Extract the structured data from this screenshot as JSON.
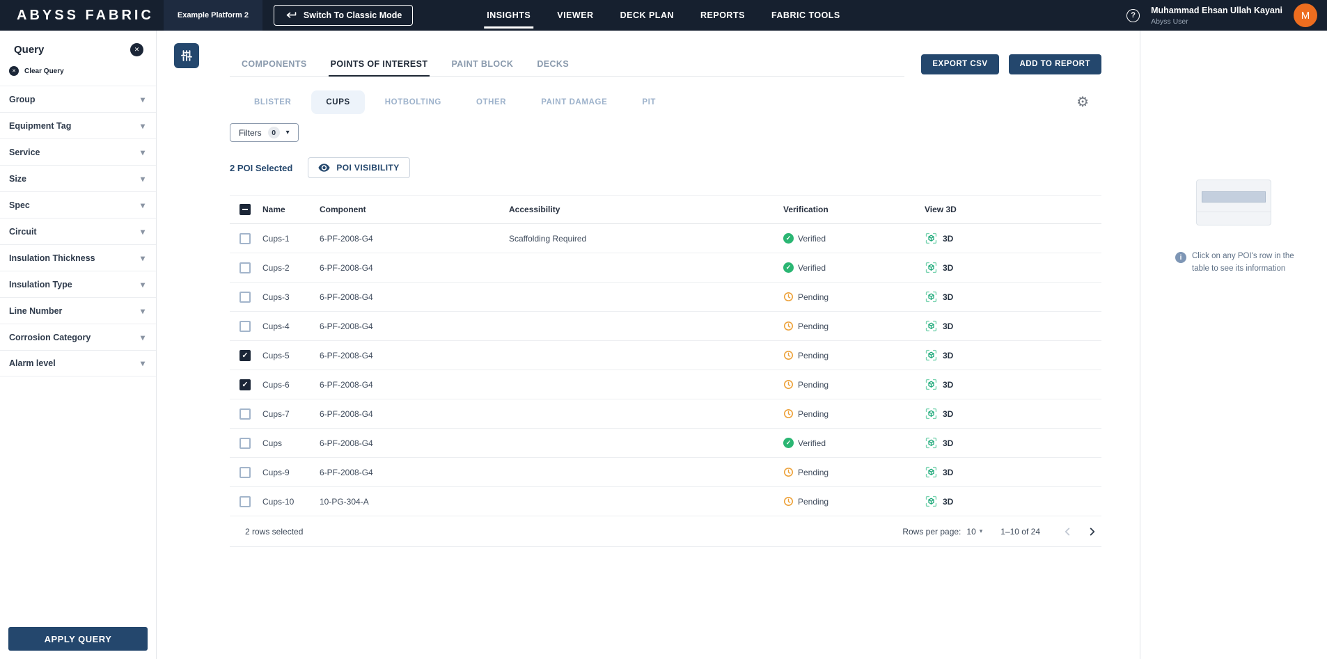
{
  "topbar": {
    "logo": "ABYSS FABRIC",
    "platform_name": "Example Platform 2",
    "classic_mode_label": "Switch To Classic Mode",
    "nav": [
      {
        "label": "INSIGHTS",
        "active": true
      },
      {
        "label": "VIEWER",
        "active": false
      },
      {
        "label": "DECK PLAN",
        "active": false
      },
      {
        "label": "REPORTS",
        "active": false
      },
      {
        "label": "FABRIC TOOLS",
        "active": false
      }
    ],
    "help_glyph": "?",
    "user": {
      "name": "Muhammad Ehsan Ullah Kayani",
      "role": "Abyss User",
      "avatar_initial": "M"
    }
  },
  "sidebar": {
    "title": "Query",
    "clear_label": "Clear Query",
    "filters": [
      "Group",
      "Equipment Tag",
      "Service",
      "Size",
      "Spec",
      "Circuit",
      "Insulation Thickness",
      "Insulation Type",
      "Line Number",
      "Corrosion Category",
      "Alarm level"
    ],
    "apply_label": "APPLY QUERY"
  },
  "main": {
    "tabs": [
      {
        "label": "COMPONENTS",
        "active": false
      },
      {
        "label": "POINTS OF INTEREST",
        "active": true
      },
      {
        "label": "PAINT BLOCK",
        "active": false
      },
      {
        "label": "DECKS",
        "active": false
      }
    ],
    "actions": {
      "export_csv": "EXPORT CSV",
      "add_to_report": "ADD TO REPORT"
    },
    "subtabs": [
      {
        "label": "BLISTER",
        "active": false
      },
      {
        "label": "CUPS",
        "active": true
      },
      {
        "label": "HOTBOLTING",
        "active": false
      },
      {
        "label": "OTHER",
        "active": false
      },
      {
        "label": "PAINT DAMAGE",
        "active": false
      },
      {
        "label": "PIT",
        "active": false
      }
    ],
    "filters_control": {
      "label": "Filters",
      "count": "0"
    },
    "selection": {
      "summary": "2 POI Selected",
      "visibility_label": "POI VISIBILITY"
    },
    "table": {
      "columns": [
        "Name",
        "Component",
        "Accessibility",
        "Verification",
        "View 3D"
      ],
      "view_3d_label": "3D",
      "rows": [
        {
          "name": "Cups-1",
          "component": "6-PF-2008-G4",
          "accessibility": "Scaffolding Required",
          "verification": "Verified",
          "checked": false
        },
        {
          "name": "Cups-2",
          "component": "6-PF-2008-G4",
          "accessibility": "",
          "verification": "Verified",
          "checked": false
        },
        {
          "name": "Cups-3",
          "component": "6-PF-2008-G4",
          "accessibility": "",
          "verification": "Pending",
          "checked": false
        },
        {
          "name": "Cups-4",
          "component": "6-PF-2008-G4",
          "accessibility": "",
          "verification": "Pending",
          "checked": false
        },
        {
          "name": "Cups-5",
          "component": "6-PF-2008-G4",
          "accessibility": "",
          "verification": "Pending",
          "checked": true
        },
        {
          "name": "Cups-6",
          "component": "6-PF-2008-G4",
          "accessibility": "",
          "verification": "Pending",
          "checked": true
        },
        {
          "name": "Cups-7",
          "component": "6-PF-2008-G4",
          "accessibility": "",
          "verification": "Pending",
          "checked": false
        },
        {
          "name": "Cups",
          "component": "6-PF-2008-G4",
          "accessibility": "",
          "verification": "Verified",
          "checked": false
        },
        {
          "name": "Cups-9",
          "component": "6-PF-2008-G4",
          "accessibility": "",
          "verification": "Pending",
          "checked": false
        },
        {
          "name": "Cups-10",
          "component": "10-PG-304-A",
          "accessibility": "",
          "verification": "Pending",
          "checked": false
        }
      ],
      "footer": {
        "selected_text": "2 rows selected",
        "rows_per_page_label": "Rows per page:",
        "rows_per_page_value": "10",
        "range_text": "1–10 of 24"
      }
    }
  },
  "right_panel": {
    "hint_text": "Click on any POI's row in the table to see its information"
  },
  "colors": {
    "topbar_bg": "#16202f",
    "navy": "#24476d",
    "avatar_orange": "#ed6d1f",
    "verified_green": "#2bb673",
    "pending_amber": "#eda23b",
    "view3d_teal": "#1ca878",
    "subtab_active_bg": "#edf3fa"
  }
}
